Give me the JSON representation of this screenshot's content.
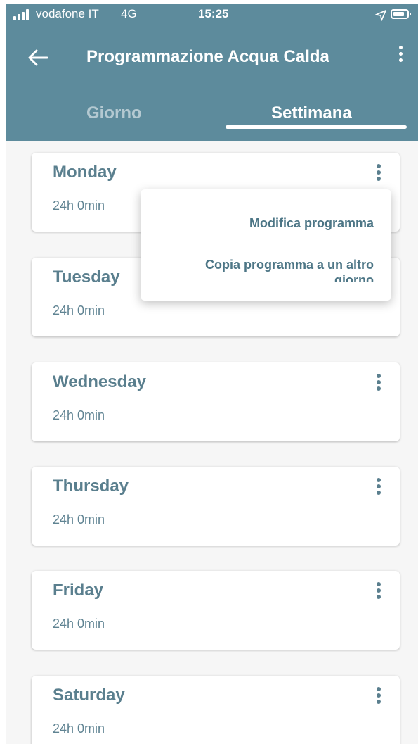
{
  "status_bar": {
    "carrier": "vodafone IT",
    "network": "4G",
    "time": "15:25"
  },
  "header": {
    "title": "Programmazione Acqua Calda",
    "back_icon": "arrow-left-icon",
    "more_icon": "more-vertical-icon"
  },
  "tabs": [
    {
      "label": "Giorno",
      "selected": false
    },
    {
      "label": "Settimana",
      "selected": true
    }
  ],
  "days": [
    {
      "name": "Monday",
      "duration": "24h 0min"
    },
    {
      "name": "Tuesday",
      "duration": "24h 0min"
    },
    {
      "name": "Wednesday",
      "duration": "24h 0min"
    },
    {
      "name": "Thursday",
      "duration": "24h 0min"
    },
    {
      "name": "Friday",
      "duration": "24h 0min"
    },
    {
      "name": "Saturday",
      "duration": "24h 0min"
    }
  ],
  "context_menu": {
    "items": [
      "Modifica programma",
      "Copia programma a un altro giorno"
    ]
  },
  "colors": {
    "header_bg": "#5d8b9c",
    "accent_text": "#5a7f8e",
    "page_bg": "#f6f6f6"
  }
}
